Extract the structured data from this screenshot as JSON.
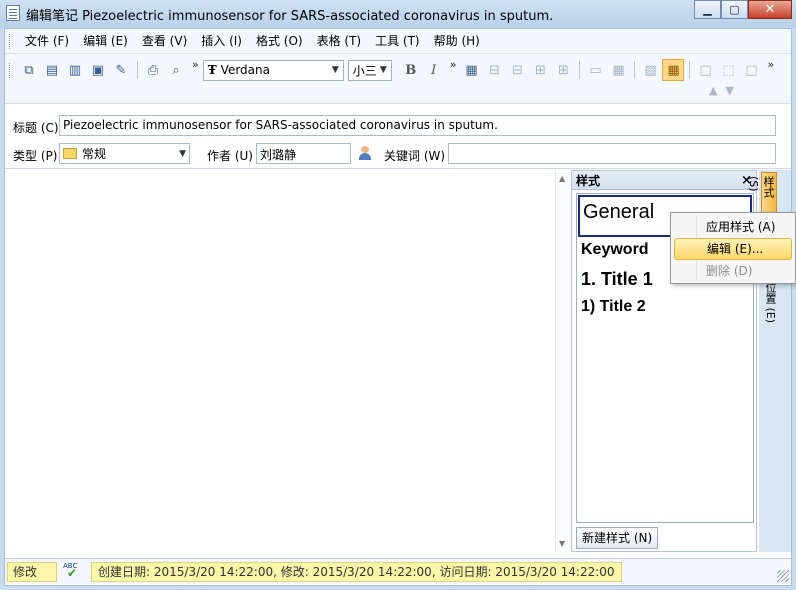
{
  "window": {
    "title": "编辑笔记 Piezoelectric immunosensor for SARS-associated coronavirus in sputum.",
    "min": "0",
    "max": "1",
    "close": "r"
  },
  "menu": [
    "文件 (F)",
    "编辑 (E)",
    "查看 (V)",
    "插入 (I)",
    "格式 (O)",
    "表格 (T)",
    "工具 (T)",
    "帮助 (H)"
  ],
  "toolbar": {
    "chevron": "»",
    "font": "Verdana",
    "font_icon": "Ŧ",
    "size": "小三",
    "bold": "B",
    "italic": "I"
  },
  "fields": {
    "title_label": "标题 (C)",
    "title_value": "Piezoelectric immunosensor for SARS-associated coronavirus in sputum.",
    "type_label": "类型 (P)",
    "type_value": "常规",
    "author_label": "作者 (U)",
    "author_value": "刘璐静",
    "keyword_label": "关键词 (W)",
    "keyword_value": ""
  },
  "style_panel": {
    "header": "样式",
    "close": "×",
    "styles": [
      "General",
      "Keyword",
      "1.  Title 1",
      "1)  Title 2"
    ],
    "new_button": "新建样式 (N)"
  },
  "side_tabs": [
    "样式 (S)",
    "位置 (E)"
  ],
  "context_menu": {
    "apply": "应用样式 (A)",
    "edit": "编辑 (E)...",
    "delete": "删除 (D)"
  },
  "status": {
    "mode": "修改",
    "spell_icon_text": "ABC",
    "dates": "创建日期: 2015/3/20 14:22:00, 修改: 2015/3/20 14:22:00, 访问日期: 2015/3/20 14:22:00"
  }
}
